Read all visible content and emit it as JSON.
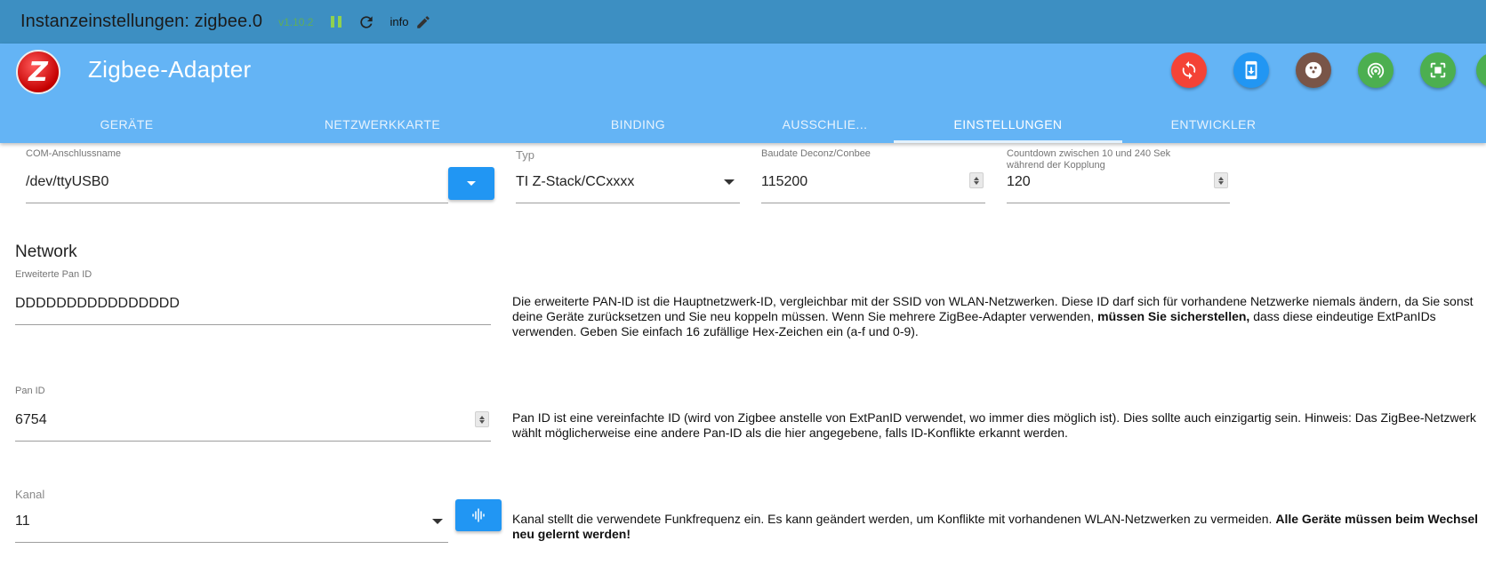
{
  "topbar": {
    "title": "Instanzeinstellungen: zigbee.0",
    "version": "v1.10.2",
    "info_label": "info"
  },
  "header": {
    "logo_letter": "Z",
    "title": "Zigbee-Adapter",
    "actions": [
      {
        "icon": "sync-icon",
        "color": "#f44336"
      },
      {
        "icon": "phone-download-icon",
        "color": "#2196f3"
      },
      {
        "icon": "bowling-ball-icon",
        "color": "#795548"
      },
      {
        "icon": "signal-broadcast-icon",
        "color": "#4caf50"
      },
      {
        "icon": "chip-icon",
        "color": "#4caf50"
      },
      {
        "icon": "partial-icon",
        "color": "#4caf50"
      }
    ],
    "tabs": [
      {
        "label": "GERÄTE",
        "active": false
      },
      {
        "label": "NETZWERKKARTE",
        "active": false
      },
      {
        "label": "BINDING",
        "active": false
      },
      {
        "label": "AUSSCHLIE...",
        "active": false
      },
      {
        "label": "EINSTELLUNGEN",
        "active": true
      },
      {
        "label": "ENTWICKLER",
        "active": false
      }
    ]
  },
  "settings": {
    "com_port": {
      "label": "COM-Anschlussname",
      "value": "/dev/ttyUSB0"
    },
    "type": {
      "label": "Typ",
      "value": "TI Z-Stack/CCxxxx"
    },
    "baudrate": {
      "label": "Baudate Deconz/Conbee",
      "value": "115200"
    },
    "countdown": {
      "label_line1": "Countdown zwischen 10 und 240 Sek",
      "label_line2": "während der Kopplung",
      "value": "120"
    },
    "network_title": "Network",
    "ext_pan_id": {
      "label": "Erweiterte Pan ID",
      "value": "DDDDDDDDDDDDDDDD",
      "desc_pre": "Die erweiterte PAN-ID ist die Hauptnetzwerk-ID, vergleichbar mit der SSID von WLAN-Netzwerken. Diese ID darf sich für vorhandene Netzwerke niemals ändern, da Sie sonst deine Geräte zurücksetzen und Sie neu koppeln müssen. Wenn Sie mehrere ZigBee-Adapter verwenden, ",
      "desc_bold": "müssen Sie sicherstellen,",
      "desc_post": " dass diese eindeutige ExtPanIDs verwenden. Geben Sie einfach 16 zufällige Hex-Zeichen ein (a-f und 0-9)."
    },
    "pan_id": {
      "label": "Pan ID",
      "value": "6754",
      "desc": "Pan ID ist eine vereinfachte ID (wird von Zigbee anstelle von ExtPanID verwendet, wo immer dies möglich ist). Dies sollte auch einzigartig sein. Hinweis: Das ZigBee-Netzwerk wählt möglicherweise eine andere Pan-ID als die hier angegebene, falls ID-Konflikte erkannt werden."
    },
    "channel": {
      "label": "Kanal",
      "value": "11",
      "desc_pre": "Kanal stellt die verwendete Funkfrequenz ein. Es kann geändert werden, um Konflikte mit vorhandenen WLAN-Netzwerken zu vermeiden. ",
      "desc_bold": "Alle Geräte müssen beim Wechsel neu gelernt werden!"
    }
  }
}
